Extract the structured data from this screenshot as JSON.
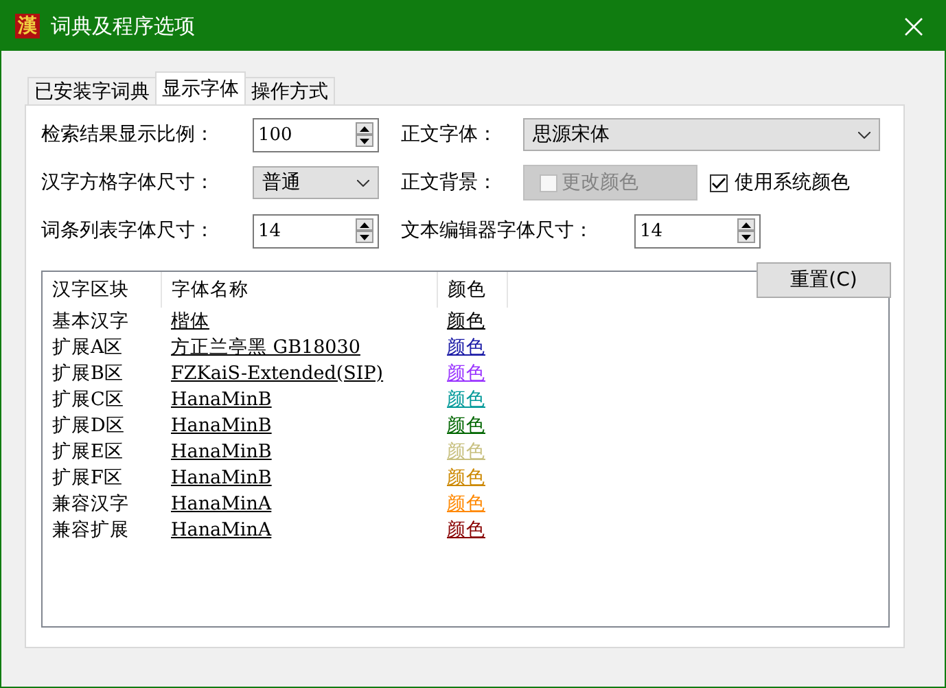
{
  "window": {
    "icon_glyph": "漢",
    "title": "词典及程序选项"
  },
  "tabs": [
    {
      "label": "已安装字词典",
      "selected": false
    },
    {
      "label": "显示字体",
      "selected": true
    },
    {
      "label": "操作方式",
      "selected": false
    }
  ],
  "settings": {
    "scale": {
      "label": "检索结果显示比例：",
      "value": "100"
    },
    "body_font": {
      "label": "正文字体：",
      "value": "思源宋体"
    },
    "cell_font_size": {
      "label": "汉字方格字体尺寸：",
      "value": "普通"
    },
    "body_background": {
      "label": "正文背景：",
      "change_color": {
        "label": "更改颜色",
        "checked": false,
        "disabled": true
      },
      "use_system_color": {
        "label": "使用系统颜色",
        "checked": true
      }
    },
    "list_font_size": {
      "label": "词条列表字体尺寸：",
      "value": "14"
    },
    "editor_font_size": {
      "label": "文本编辑器字体尺寸：",
      "value": "14"
    }
  },
  "table": {
    "columns": [
      "汉字区块",
      "字体名称",
      "颜色"
    ],
    "rows": [
      {
        "block": "基本汉字",
        "font": "楷体",
        "color_label": "颜色",
        "color": "#000000"
      },
      {
        "block": "扩展A区",
        "font": "方正兰亭黑 GB18030",
        "color_label": "颜色",
        "color": "#1a1aa6"
      },
      {
        "block": "扩展B区",
        "font": "FZKaiS-Extended(SIP)",
        "color_label": "颜色",
        "color": "#9933ff"
      },
      {
        "block": "扩展C区",
        "font": "HanaMinB",
        "color_label": "颜色",
        "color": "#009999"
      },
      {
        "block": "扩展D区",
        "font": "HanaMinB",
        "color_label": "颜色",
        "color": "#006600"
      },
      {
        "block": "扩展E区",
        "font": "HanaMinB",
        "color_label": "颜色",
        "color": "#c8c080"
      },
      {
        "block": "扩展F区",
        "font": "HanaMinB",
        "color_label": "颜色",
        "color": "#cc8800"
      },
      {
        "block": "兼容汉字",
        "font": "HanaMinA",
        "color_label": "颜色",
        "color": "#ff8800"
      },
      {
        "block": "兼容扩展",
        "font": "HanaMinA",
        "color_label": "颜色",
        "color": "#880000"
      }
    ]
  },
  "reset_button": "重置(C)"
}
